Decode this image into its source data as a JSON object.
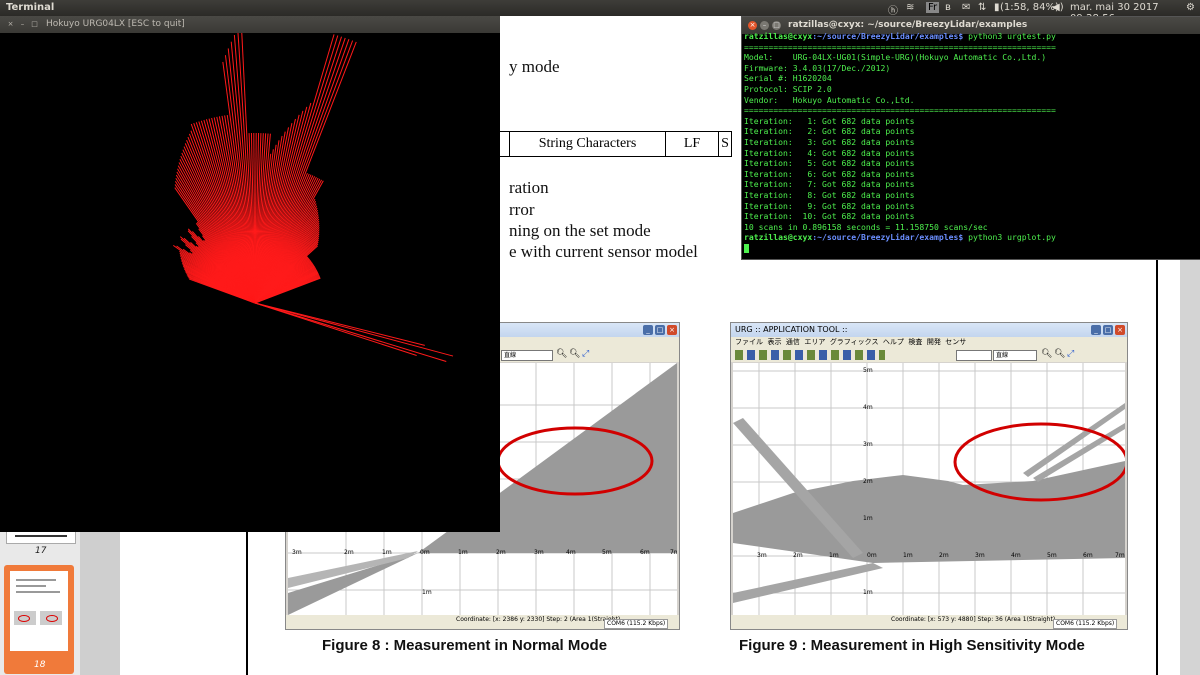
{
  "topbar": {
    "app_title": "Terminal",
    "battery": "(1:58, 84%)",
    "datetime": "mar. mai 30 2017 09:28:56"
  },
  "document": {
    "lines": [
      "y mode",
      "ration",
      "rror",
      "ning on the set mode",
      "e with current sensor model"
    ],
    "table_cells": [
      "",
      "String Characters",
      "LF",
      "S"
    ],
    "figures": [
      {
        "title": "",
        "caption": "Figure 8 : Measurement in Normal Mode",
        "toolbar_select": "直線",
        "status": "Coordinate: [x: 2386  y: 2330]  Step: 2 (Area 1(Straight)",
        "port": "COM6 (115.2 Kbps)",
        "axis_labels": [
          "3m",
          "2m",
          "1m",
          "0m",
          "1m",
          "2m",
          "3m",
          "4m",
          "5m",
          "6m",
          "7m",
          "1m"
        ]
      },
      {
        "title": "URG :: APPLICATION TOOL ::",
        "caption": "Figure 9 : Measurement in High Sensitivity Mode",
        "menu": [
          "ファイル",
          "表示",
          "通信",
          "エリア",
          "グラフィックス",
          "ヘルプ",
          "検査",
          "開発",
          "センサ"
        ],
        "toolbar_select": "直線",
        "status": "Coordinate: [x: 573  y: 4880]  Step: 36 (Area 1(Straight)",
        "port": "COM6 (115.2 Kbps)",
        "axis_labels": [
          "5m",
          "4m",
          "3m",
          "2m",
          "1m",
          "3m",
          "2m",
          "1m",
          "0m",
          "1m",
          "2m",
          "3m",
          "4m",
          "5m",
          "6m",
          "7m",
          "1m"
        ]
      }
    ],
    "page_numbers": [
      "17",
      "18"
    ]
  },
  "hokuyo": {
    "title": "Hokuyo URG04LX  [ESC to quit]"
  },
  "terminal": {
    "title": "ratzillas@cxyx: ~/source/BreezyLidar/examples",
    "prompt_user": "ratzillas@cxyx",
    "prompt_path": ":~/source/BreezyLidar/examples$",
    "cmd1": " python3 urgtest.py",
    "cmd2": " python3 urgplot.py",
    "separator": "================================================================",
    "info": [
      "Model:    URG-04LX-UG01(Simple-URG)(Hokuyo Automatic Co.,Ltd.)",
      "Firmware: 3.4.03(17/Dec./2012)",
      "Serial #: H1620204",
      "Protocol: SCIP 2.0",
      "Vendor:   Hokuyo Automatic Co.,Ltd."
    ],
    "iterations": [
      "Iteration:   1: Got 682 data points",
      "Iteration:   2: Got 682 data points",
      "Iteration:   3: Got 682 data points",
      "Iteration:   4: Got 682 data points",
      "Iteration:   5: Got 682 data points",
      "Iteration:   6: Got 682 data points",
      "Iteration:   7: Got 682 data points",
      "Iteration:   8: Got 682 data points",
      "Iteration:   9: Got 682 data points",
      "Iteration:  10: Got 682 data points"
    ],
    "summary": "10 scans in 0.896158 seconds = 11.158750 scans/sec"
  },
  "colors": {
    "scan_red": "#ff1a1a",
    "terminal_green": "#4ef04e",
    "ellipse_red": "#d10000",
    "thumb_highlight": "#f07a3a"
  }
}
